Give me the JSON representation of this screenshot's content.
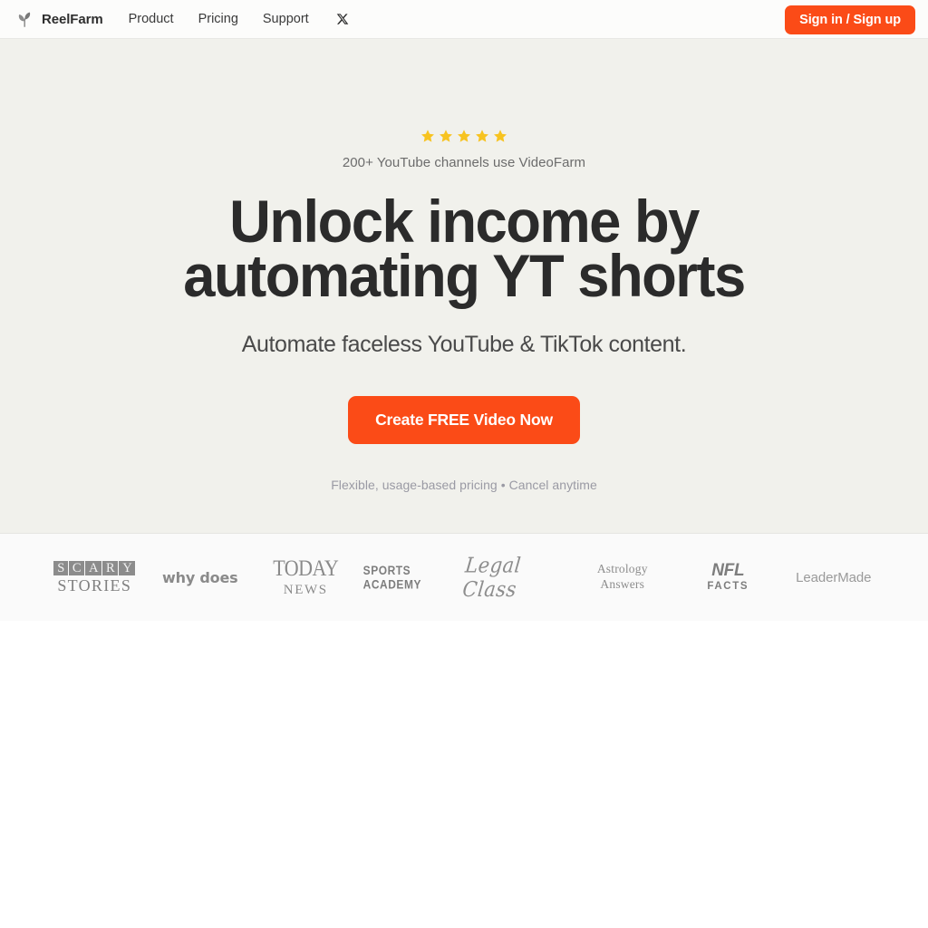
{
  "theme": {
    "accent": "#fb4b17",
    "hero_bg": "#f1f1ec",
    "nav_bg": "#fcfcfb",
    "logos_bg": "#fafafa",
    "star_color": "#f7c320",
    "heading_color": "#2b2b2b",
    "muted_text": "#9a9aa4"
  },
  "nav": {
    "brand": "ReelFarm",
    "brand_icon": "sprout-icon",
    "links": [
      {
        "label": "Product"
      },
      {
        "label": "Pricing"
      },
      {
        "label": "Support"
      }
    ],
    "social_icon": "x-twitter-icon",
    "auth_button": "Sign in / Sign up"
  },
  "hero": {
    "rating_icon": "star-icon",
    "rating_stars": 5,
    "social_proof": "200+ YouTube channels use VideoFarm",
    "headline_line1": "Unlock income by",
    "headline_line2": "automating YT shorts",
    "subheadline": "Automate faceless YouTube & TikTok content.",
    "cta_label": "Create FREE Video Now",
    "fineprint": "Flexible, usage-based pricing • Cancel anytime"
  },
  "logos": [
    {
      "id": "scary-stories",
      "line1": "SCARY",
      "line2": "STORIES",
      "letters": [
        "S",
        "C",
        "A",
        "R",
        "Y"
      ]
    },
    {
      "id": "why-does",
      "line1": "why does"
    },
    {
      "id": "today-news",
      "line1": "TODAY",
      "line2": "NEWS"
    },
    {
      "id": "sports-academy",
      "line1": "SPORTS ACADEMY"
    },
    {
      "id": "legal-class",
      "line1": "Legal Class"
    },
    {
      "id": "astrology-answers",
      "line1": "Astrology",
      "line2": "Answers"
    },
    {
      "id": "nfl-facts",
      "line1": "NFL",
      "line2": "FACTS"
    },
    {
      "id": "leadermade",
      "line1": "LeaderMade"
    }
  ]
}
